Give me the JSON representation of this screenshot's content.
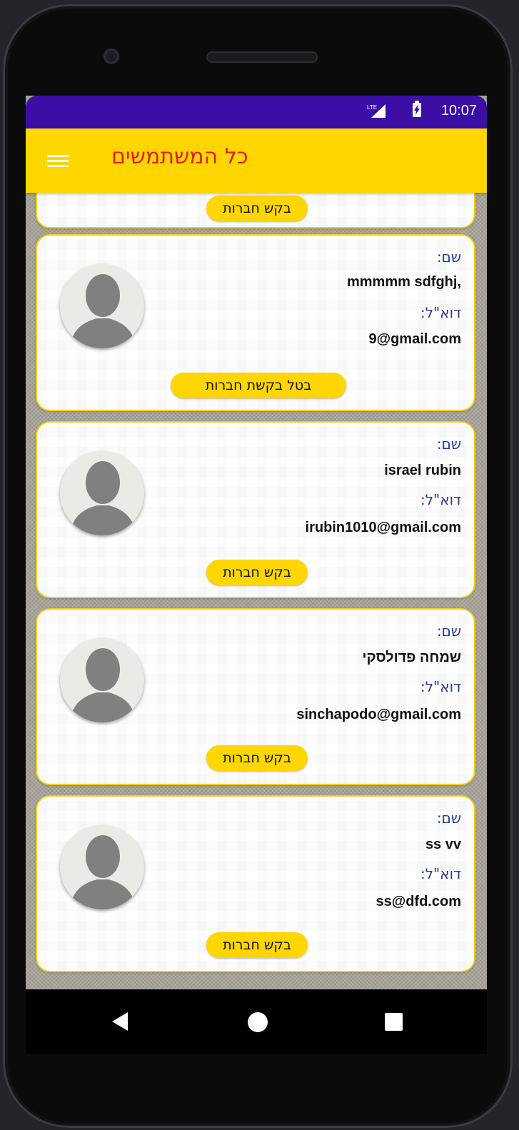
{
  "statusbar": {
    "time": "10:07",
    "network": "LTE"
  },
  "appbar": {
    "title": "כל המשתמשים"
  },
  "labels": {
    "name": "שם:",
    "email": "דוא\"ל:"
  },
  "partial_card": {
    "button": "בקש חברות"
  },
  "users": [
    {
      "name": "mmmmm sdfghj,",
      "email": "9@gmail.com",
      "button": "בטל בקשת חברות"
    },
    {
      "name": "israel  rubin",
      "email": "irubin1010@gmail.com",
      "button": "בקש חברות"
    },
    {
      "name": "שמחה פדולסקי",
      "email": "sinchapodo@gmail.com",
      "button": "בקש חברות"
    },
    {
      "name": "ss vv",
      "email": "ss@dfd.com",
      "button": "בקש חברות"
    }
  ],
  "colors": {
    "statusbar": "#3b0fa6",
    "appbar": "#ffd600",
    "title": "#e0201c",
    "label": "#2a3a8c",
    "card_border": "#f2cf1a"
  }
}
